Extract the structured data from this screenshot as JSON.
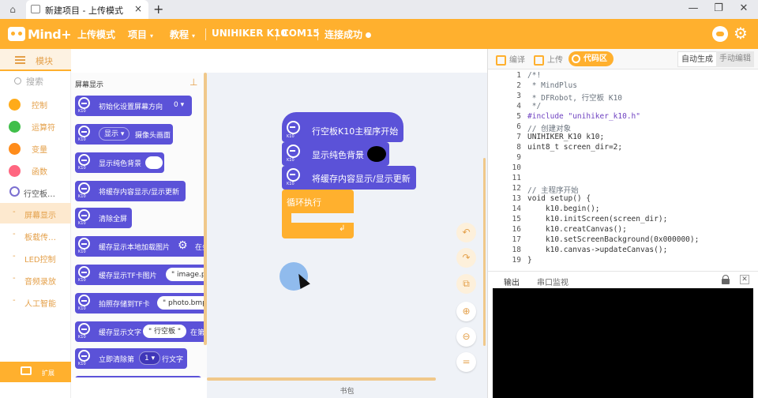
{
  "window": {
    "tab_title": "新建项目 - 上传模式",
    "tab_add": "+",
    "tab_close": "×",
    "minimize": "—",
    "restore": "❐",
    "close": "✕"
  },
  "nav": {
    "logo": "Mind+",
    "mode": "上传模式",
    "project": "项目",
    "tutorial": "教程",
    "board": "UNIHIKER K10",
    "port": "COM15",
    "status": "连接成功",
    "caret": "▾",
    "accent_color": "#ffb02e"
  },
  "sidebar": {
    "header": "模块",
    "search_placeholder": "搜索",
    "categories": [
      {
        "label": "控制",
        "color": "#ffab19"
      },
      {
        "label": "运算符",
        "color": "#40bf4a"
      },
      {
        "label": "变量",
        "color": "#ff8c1a"
      },
      {
        "label": "函数",
        "color": "#ff6680"
      }
    ],
    "board_category": "行空板…",
    "sub_items": [
      "屏幕显示",
      "板载传…",
      "LED控制",
      "音频录放",
      "人工智能"
    ],
    "extensions": "扩展"
  },
  "palette": {
    "title": "屏幕显示",
    "pin_icon": "pin-icon",
    "k10_tag": "K10",
    "blocks": [
      {
        "label": "初始化设置屏幕方向",
        "value": "0"
      },
      {
        "label_a": "显示",
        "label_b": "摄像头画面"
      },
      {
        "label": "显示纯色背景"
      },
      {
        "label": "将缓存内容显示/显示更新"
      },
      {
        "label": "清除全屏"
      },
      {
        "label": "缓存显示本地加载图片",
        "suffix": "在坐"
      },
      {
        "label": "缓存显示TF卡图片",
        "value": "image.png"
      },
      {
        "label": "拍照存储到TF卡",
        "value": "photo.bmp"
      },
      {
        "label": "缓存显示文字",
        "value": "行空板",
        "suffix": "在第"
      },
      {
        "label": "立即清除第",
        "value": "1",
        "suffix": "行文字"
      }
    ]
  },
  "workspace": {
    "hat_label": "行空板K10主程序开始",
    "block_bg": "显示纯色背景",
    "block_update": "将缓存内容显示/显示更新",
    "loop_label": "循环执行",
    "loop_arrow": "↲",
    "controls": [
      "undo-icon",
      "redo-icon",
      "cleanup-icon",
      "zoom-in-icon",
      "zoom-out-icon",
      "zoom-reset-icon"
    ],
    "control_glyphs": [
      "↶",
      "↷",
      "⧉",
      "⊕",
      "⊖",
      "="
    ]
  },
  "right_panel": {
    "compile": "编译",
    "upload": "上传",
    "code_area": "代码区",
    "auto_gen": "自动生成",
    "manual_edit": "手动编辑",
    "code_lines": [
      {
        "n": "1",
        "t": "/*!",
        "c": "cm"
      },
      {
        "n": "2",
        "t": " * MindPlus",
        "c": "cm"
      },
      {
        "n": "3",
        "t": " * DFRobot, 行空板 K10",
        "c": "cm"
      },
      {
        "n": "4",
        "t": " */",
        "c": "cm"
      },
      {
        "n": "5",
        "t": "#include \"unihiker_k10.h\"",
        "c": "kw"
      },
      {
        "n": "6",
        "t": "// 创建对象",
        "c": "cm"
      },
      {
        "n": "7",
        "t": "UNIHIKER_K10 k10;",
        "c": ""
      },
      {
        "n": "8",
        "t": "uint8_t screen_dir=2;",
        "c": ""
      },
      {
        "n": "9",
        "t": "",
        "c": ""
      },
      {
        "n": "10",
        "t": "",
        "c": ""
      },
      {
        "n": "11",
        "t": "",
        "c": ""
      },
      {
        "n": "12",
        "t": "// 主程序开始",
        "c": "cm"
      },
      {
        "n": "13",
        "t": "void setup() {",
        "c": ""
      },
      {
        "n": "14",
        "t": "    k10.begin();",
        "c": ""
      },
      {
        "n": "15",
        "t": "    k10.initScreen(screen_dir);",
        "c": ""
      },
      {
        "n": "16",
        "t": "    k10.creatCanvas();",
        "c": ""
      },
      {
        "n": "17",
        "t": "    k10.setScreenBackground(0x000000);",
        "c": ""
      },
      {
        "n": "18",
        "t": "    k10.canvas->updateCanvas();",
        "c": ""
      },
      {
        "n": "19",
        "t": "}",
        "c": ""
      }
    ],
    "output_tab": "输出",
    "serial_tab": "串口监视",
    "clear": "✕"
  },
  "footer": {
    "label": "书包"
  }
}
